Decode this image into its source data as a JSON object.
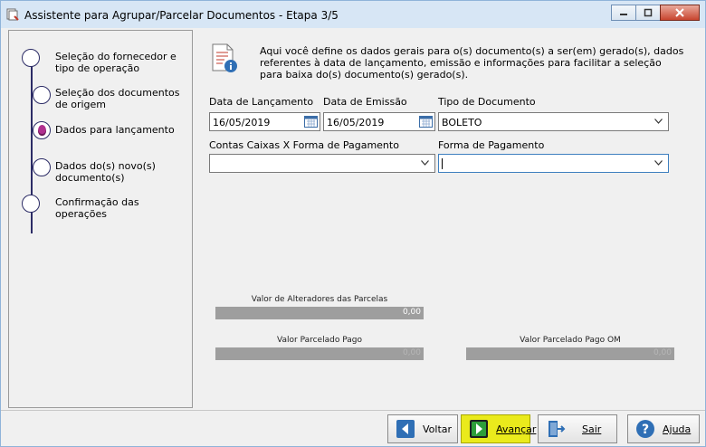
{
  "window": {
    "title": "Assistente para Agrupar/Parcelar Documentos - Etapa 3/5",
    "controls": [
      "minimize",
      "maximize",
      "close"
    ]
  },
  "steps": [
    {
      "label": "Seleção do fornecedor e tipo de operação",
      "state": "done"
    },
    {
      "label": "Seleção dos documentos de origem",
      "state": "done"
    },
    {
      "label": "Dados para lançamento",
      "state": "current"
    },
    {
      "label": "Dados do(s) novo(s) documento(s)",
      "state": "pending"
    },
    {
      "label": "Confirmação das operações",
      "state": "pending"
    }
  ],
  "info": {
    "icon": "document-info-icon",
    "text": "Aqui você define os dados gerais para o(s) documento(s) a ser(em) gerado(s), dados referentes à data de lançamento, emissão e informações para facilitar a seleção para baixa do(s) documento(s) gerado(s)."
  },
  "form": {
    "data_lancamento": {
      "label": "Data de Lançamento",
      "value": "16/05/2019"
    },
    "data_emissao": {
      "label": "Data de Emissão",
      "value": "16/05/2019"
    },
    "tipo_documento": {
      "label": "Tipo de Documento",
      "value": "BOLETO"
    },
    "contas_caixas": {
      "label": "Contas Caixas X Forma de Pagamento",
      "value": ""
    },
    "forma_pagamento": {
      "label": "Forma de Pagamento",
      "value": ""
    }
  },
  "totals": {
    "alteradores": {
      "label": "Valor de Alteradores das Parcelas",
      "value": "0,00"
    },
    "parcelado_pago": {
      "label": "Valor Parcelado Pago",
      "value": "0,00"
    },
    "parcelado_pago_om": {
      "label": "Valor Parcelado Pago OM",
      "value": "0,00"
    }
  },
  "buttons": {
    "voltar": "Voltar",
    "avancar": "Avançar",
    "sair": "Sair",
    "ajuda": "Ajuda"
  },
  "colors": {
    "title_bar": "#d7e6f5",
    "step_line": "#2c2c66",
    "current_step": "#b0308f",
    "highlight_button": "#eaea1c",
    "field_focus": "#3d7fbf"
  }
}
